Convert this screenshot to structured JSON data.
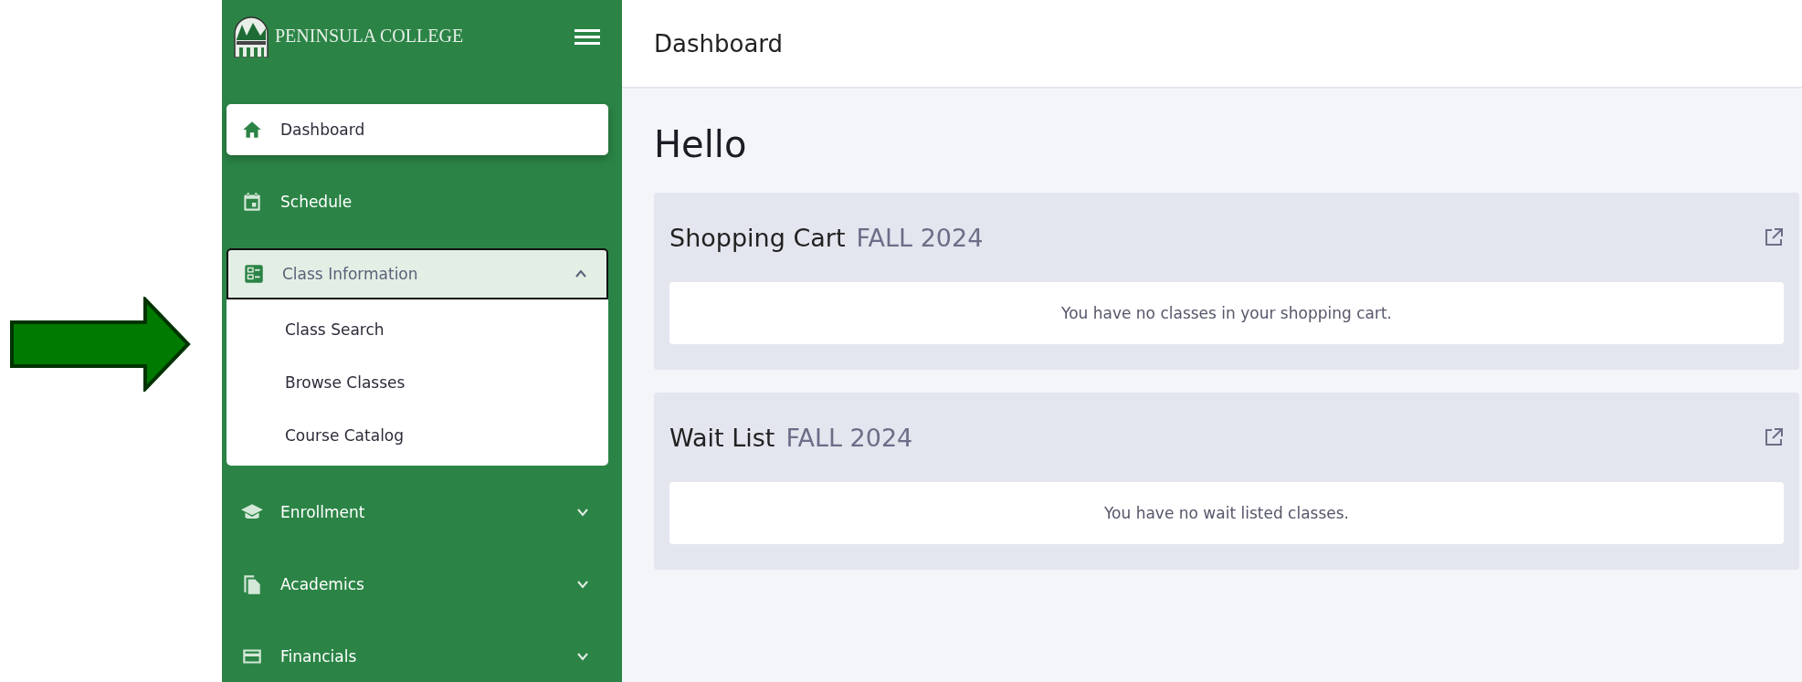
{
  "sidebar": {
    "logo_text": "PENINSULA COLLEGE",
    "items": [
      {
        "label": "Dashboard",
        "kind": "link",
        "selected": true
      },
      {
        "label": "Schedule",
        "kind": "link",
        "selected": false
      },
      {
        "label": "Class Information",
        "kind": "group",
        "selected": false,
        "expanded": true,
        "children": [
          {
            "label": "Class Search"
          },
          {
            "label": "Browse Classes"
          },
          {
            "label": "Course Catalog"
          }
        ]
      },
      {
        "label": "Enrollment",
        "kind": "group",
        "selected": false,
        "expanded": false
      },
      {
        "label": "Academics",
        "kind": "group",
        "selected": false,
        "expanded": false
      },
      {
        "label": "Financials",
        "kind": "group",
        "selected": false,
        "expanded": false
      }
    ]
  },
  "header": {
    "title": "Dashboard"
  },
  "greeting": "Hello",
  "cards": [
    {
      "title": "Shopping Cart",
      "term": "FALL 2024",
      "message": "You have no classes in your shopping cart."
    },
    {
      "title": "Wait List",
      "term": "FALL 2024",
      "message": "You have no wait listed classes."
    }
  ]
}
